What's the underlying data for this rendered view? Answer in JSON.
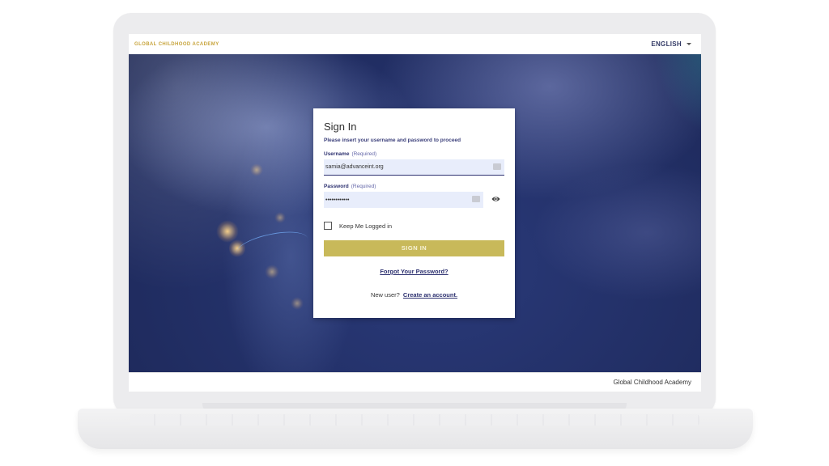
{
  "header": {
    "brand": "GLOBAL CHILDHOOD ACADEMY",
    "language": "ENGLISH"
  },
  "signin": {
    "title": "Sign In",
    "subtitle": "Please insert your username and password to proceed",
    "username_label": "Username",
    "username_required": "(Required)",
    "username_value": "samia@advanceint.org",
    "password_label": "Password",
    "password_required": "(Required)",
    "password_mask": "••••••••••••",
    "keep_logged_in": "Keep Me Logged in",
    "signin_button": "SIGN IN",
    "forgot_password": "Forgot Your Password?",
    "new_user": "New user?",
    "create_account": "Create an account."
  },
  "footer": {
    "text": "Global Childhood Academy"
  },
  "icons": {
    "language_caret": "chevron-down-icon",
    "username_key": "keyboard-icon",
    "password_key": "keyboard-icon",
    "show_password": "eye-icon"
  },
  "colors": {
    "brand": "#c7a43c",
    "accent": "#2d3170",
    "button": "#c8b95a",
    "field_bg": "#e8edfb"
  }
}
